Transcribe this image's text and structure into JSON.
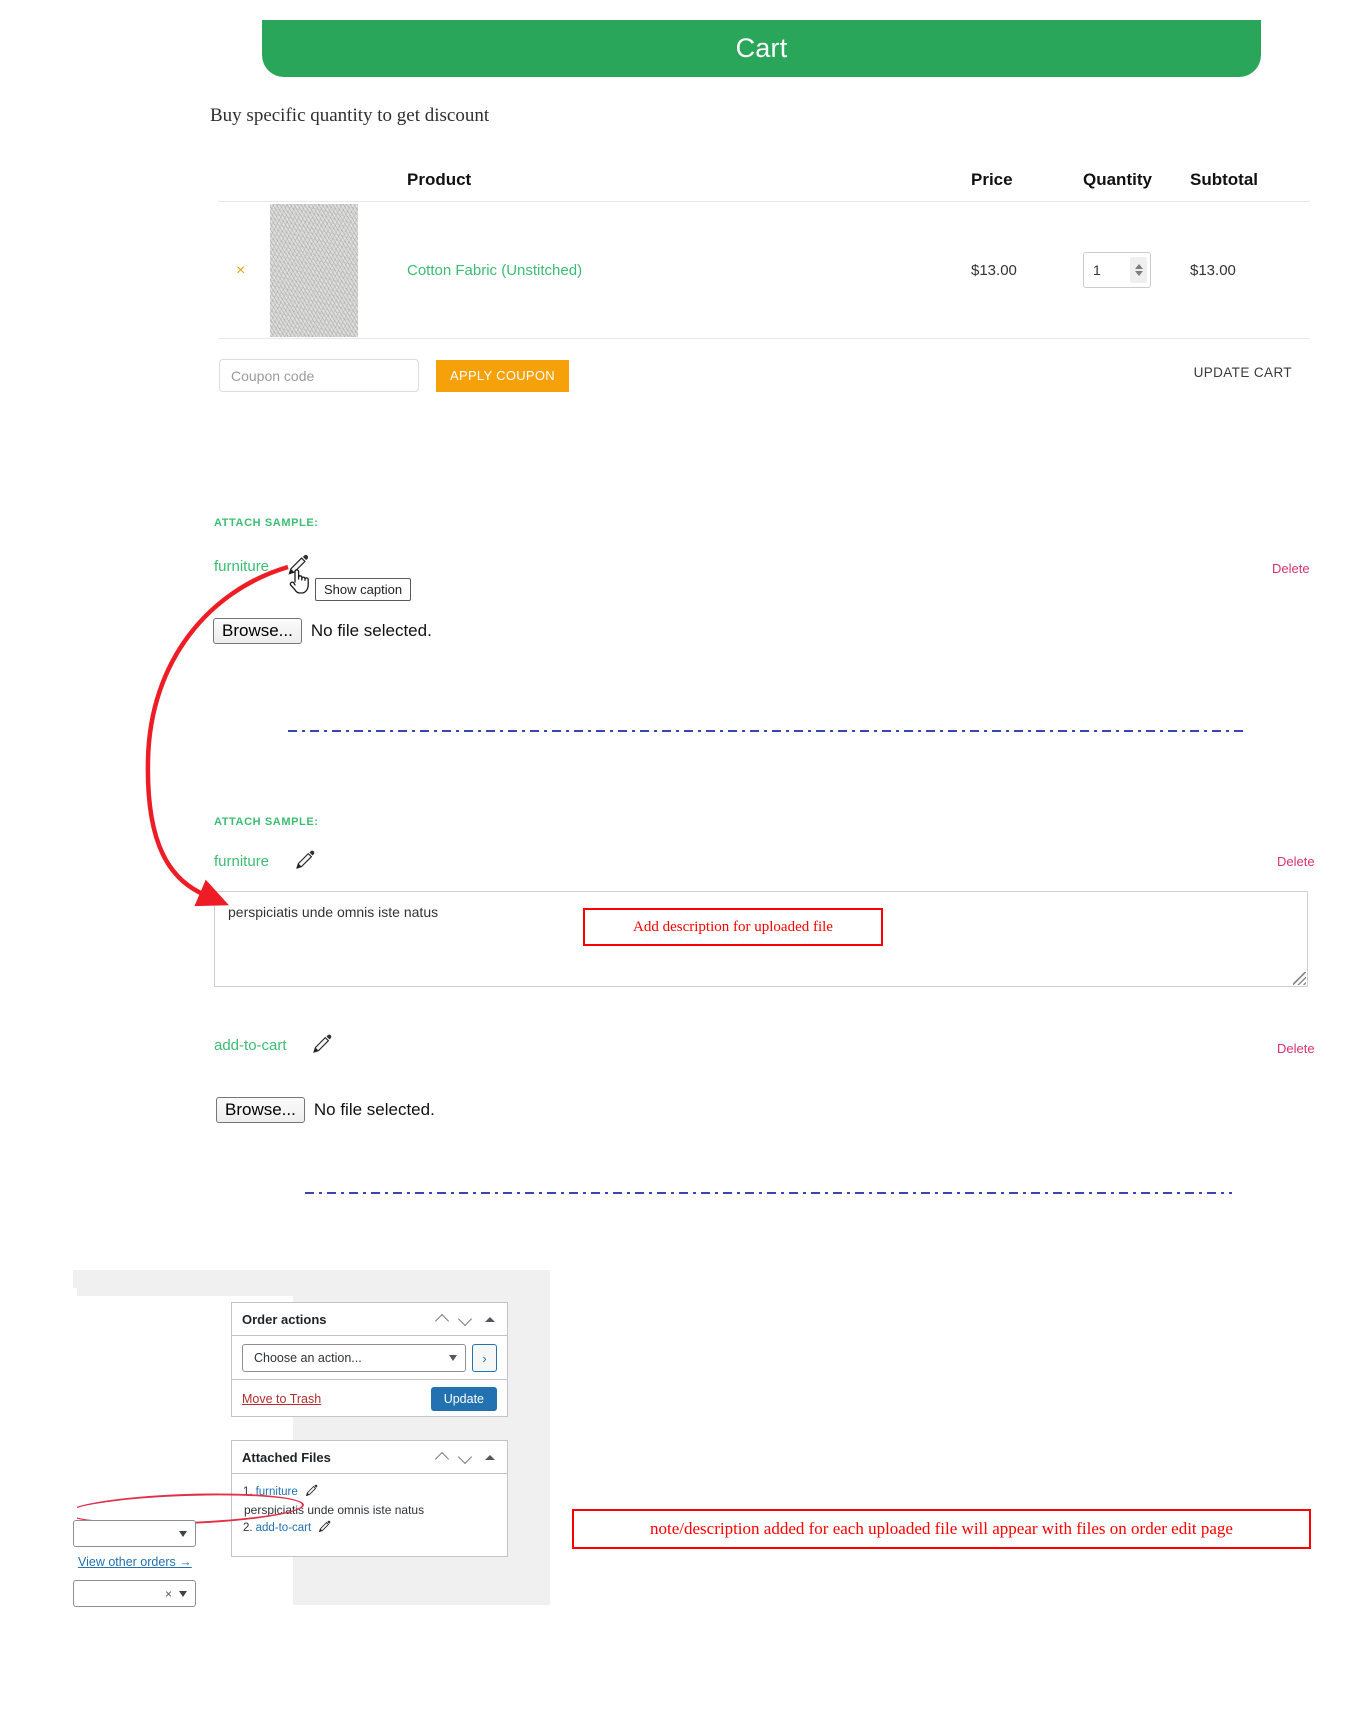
{
  "header": {
    "title": "Cart"
  },
  "subtitle": "Buy specific quantity to get discount",
  "cart": {
    "columns": {
      "remove": "×",
      "product": "Product",
      "price": "Price",
      "quantity": "Quantity",
      "subtotal": "Subtotal"
    },
    "rows": [
      {
        "product": "Cotton Fabric (Unstitched)",
        "price": "$13.00",
        "quantity": "1",
        "subtotal": "$13.00"
      }
    ],
    "coupon_placeholder": "Coupon code",
    "coupon_value": "",
    "apply_coupon_label": "APPLY COUPON",
    "update_cart_label": "UPDATE CART"
  },
  "attach_blocks": [
    {
      "label": "ATTACH SAMPLE:",
      "file_name": "furniture",
      "delete_label": "Delete",
      "tooltip": "Show caption",
      "browse_label": "Browse...",
      "no_file_label": "No file selected."
    },
    {
      "label": "ATTACH SAMPLE:",
      "file_name": "furniture",
      "delete_label": "Delete",
      "description_value": "perspiciatis unde omnis iste natus"
    },
    {
      "file_name": "add-to-cart",
      "delete_label": "Delete",
      "browse_label": "Browse...",
      "no_file_label": "No file selected."
    }
  ],
  "annotations": {
    "add_description": "Add description for uploaded file",
    "order_edit_note": "note/description added for each uploaded file will appear with files on order edit page"
  },
  "admin": {
    "order_actions": {
      "title": "Order actions",
      "select_value": "Choose an action...",
      "go_label": "›",
      "trash_label": "Move to Trash",
      "update_label": "Update"
    },
    "attached_files": {
      "title": "Attached Files",
      "items": [
        {
          "index": "1.",
          "name": "furniture"
        },
        {
          "index": "2.",
          "name": "add-to-cart"
        }
      ],
      "note": "perspiciatis unde omnis iste natus"
    },
    "view_other_orders": "View other orders →",
    "clear_symbol": "×"
  },
  "colors": {
    "brand_green": "#29a65a",
    "link_green": "#3bbd72",
    "coupon_orange": "#f7a10a",
    "delete_pink": "#d6336c",
    "annotation_red": "#ff0000",
    "divider_blue": "#3b44b5",
    "wp_blue": "#2271b1"
  }
}
